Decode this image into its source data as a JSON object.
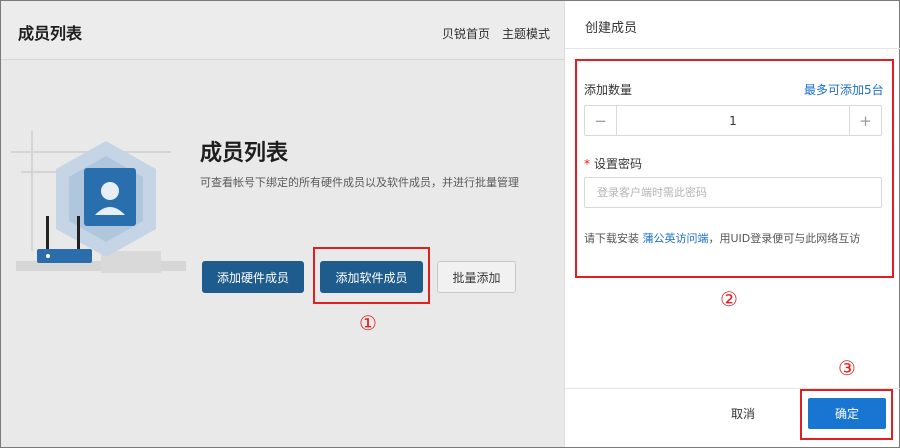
{
  "header": {
    "title": "成员列表",
    "nav": [
      "贝锐首页",
      "主题模式"
    ]
  },
  "main": {
    "title": "成员列表",
    "description": "可查看帐号下绑定的所有硬件成员以及软件成员，并进行批量管理",
    "buttons": {
      "add_hardware": "添加硬件成员",
      "add_software": "添加软件成员",
      "batch_add": "批量添加"
    }
  },
  "drawer": {
    "title": "创建成员",
    "count_label": "添加数量",
    "max_hint": "最多可添加5台",
    "count_value": "1",
    "minus_symbol": "−",
    "plus_symbol": "+",
    "required_mark": "*",
    "password_label": "设置密码",
    "password_placeholder": "登录客户端时需此密码",
    "hint_prefix": "请下载安装 ",
    "hint_link": "蒲公英访问端",
    "hint_suffix": "，用UID登录便可与此网络互访",
    "cancel_label": "取消",
    "confirm_label": "确定"
  },
  "annotations": {
    "step1": "①",
    "step2": "②",
    "step3": "③",
    "color": "#e02020"
  },
  "colors": {
    "primary_dark": "#1f5c8e",
    "primary": "#1876d2",
    "link": "#1a6fd0"
  }
}
